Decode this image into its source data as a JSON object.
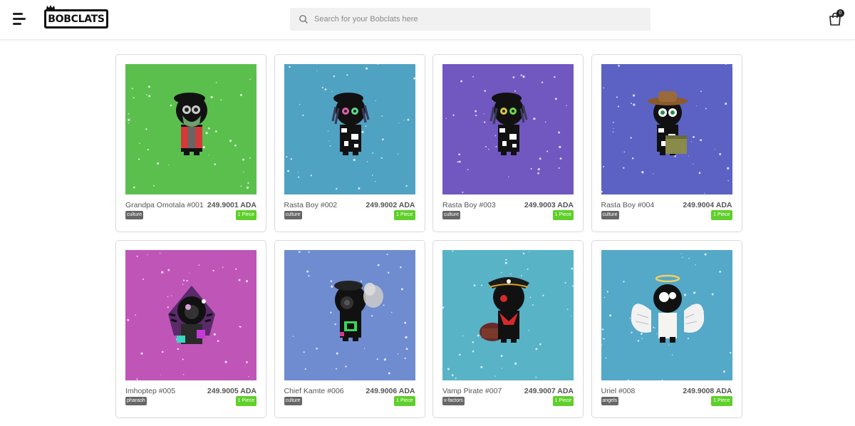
{
  "header": {
    "logo_text": "BOBCLATS",
    "search_placeholder": "Search for your Bobclats here",
    "cart_count": "0"
  },
  "products": [
    {
      "name": "Grandpa Omotala #001",
      "price": "249.9001 ADA",
      "tag": "culture",
      "qty": "1 Piece",
      "bg": "#5bbf4e"
    },
    {
      "name": "Rasta Boy #002",
      "price": "249.9002 ADA",
      "tag": "culture",
      "qty": "1 Piece",
      "bg": "#4fa2c2"
    },
    {
      "name": "Rasta Boy #003",
      "price": "249.9003 ADA",
      "tag": "culture",
      "qty": "1 Piece",
      "bg": "#7157c0"
    },
    {
      "name": "Rasta Boy #004",
      "price": "249.9004 ADA",
      "tag": "culture",
      "qty": "1 Piece",
      "bg": "#5b62c4"
    },
    {
      "name": "Imhoptep #005",
      "price": "249.9005 ADA",
      "tag": "pharaoh",
      "qty": "1 Piece",
      "bg": "#c055b8"
    },
    {
      "name": "Chief Kamte #006",
      "price": "249.9006 ADA",
      "tag": "culture",
      "qty": "1 Piece",
      "bg": "#6f8cd0"
    },
    {
      "name": "Vamp Pirate #007",
      "price": "249.9007 ADA",
      "tag": "x-factors",
      "qty": "1 Piece",
      "bg": "#58b3c6"
    },
    {
      "name": "Uriel #008",
      "price": "249.9008 ADA",
      "tag": "angels",
      "qty": "1 Piece",
      "bg": "#54a8c8"
    }
  ]
}
